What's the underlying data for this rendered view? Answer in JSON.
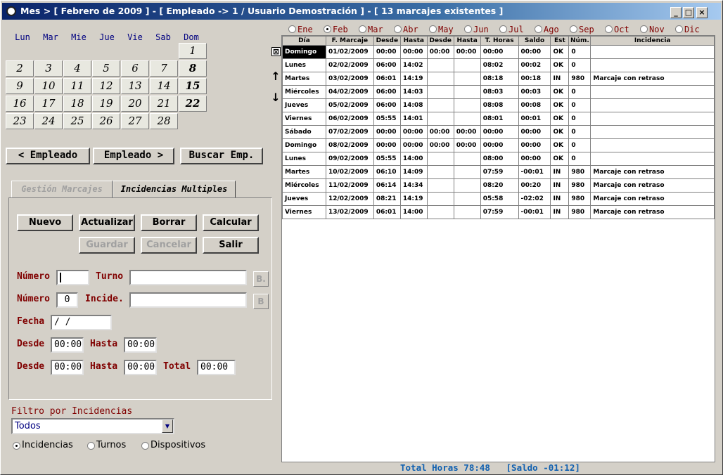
{
  "title": "Mes > [ Febrero de 2009 ] - [ Empleado -> 1 / Usuario Demostración ] - [ 13 marcajes existentes ]",
  "window_buttons": {
    "minimize": "_",
    "maximize": "□",
    "close": "×"
  },
  "calendar": {
    "weekdays": [
      "Lun",
      "Mar",
      "Mie",
      "Jue",
      "Vie",
      "Sab",
      "Dom"
    ],
    "days": [
      "1",
      "2",
      "3",
      "4",
      "5",
      "6",
      "7",
      "8",
      "9",
      "10",
      "11",
      "12",
      "13",
      "14",
      "15",
      "16",
      "17",
      "18",
      "19",
      "20",
      "21",
      "22",
      "23",
      "24",
      "25",
      "26",
      "27",
      "28"
    ]
  },
  "employee_nav": {
    "prev": "< Empleado",
    "next": "Empleado >",
    "search": "Buscar Emp."
  },
  "tabs": {
    "gestion": "Gestión Marcajes",
    "incidencias": "Incidencias Multiples"
  },
  "actions": {
    "nuevo": "Nuevo",
    "actualizar": "Actualizar",
    "borrar": "Borrar",
    "calcular": "Calcular",
    "guardar": "Guardar",
    "cancelar": "Cancelar",
    "salir": "Salir"
  },
  "form": {
    "numero_label": "Número",
    "numero_value": "",
    "turno_label": "Turno",
    "turno_value": "",
    "turno_btn": "B.",
    "numero2_label": "Número",
    "numero2_value": "0",
    "incide_label": "Incide.",
    "incide_value": "",
    "incide_btn": "B",
    "fecha_label": "Fecha",
    "fecha_value": " / /",
    "desde1_label": "Desde",
    "desde1_value": "00:00",
    "hasta1_label": "Hasta",
    "hasta1_value": "00:00",
    "desde2_label": "Desde",
    "desde2_value": "00:00",
    "hasta2_label": "Hasta",
    "hasta2_value": "00:00",
    "total_label": "Total",
    "total_value": "00:00"
  },
  "filter": {
    "label": "Filtro por Incidencias",
    "selected": "Todos",
    "radios": [
      "Incidencias",
      "Turnos",
      "Dispositivos"
    ],
    "radio_selected": 0
  },
  "months": {
    "items": [
      "Ene",
      "Feb",
      "Mar",
      "Abr",
      "May",
      "Jun",
      "Jul",
      "Ago",
      "Sep",
      "Oct",
      "Nov",
      "Dic"
    ],
    "selected": 1
  },
  "grid": {
    "columns": [
      "Día",
      "F. Marcaje",
      "Desde",
      "Hasta",
      "Desde",
      "Hasta",
      "T. Horas",
      "Saldo",
      "Est",
      "Núm.",
      "Incidencia"
    ],
    "rows": [
      [
        "Domingo",
        "01/02/2009",
        "00:00",
        "00:00",
        "00:00",
        "00:00",
        "00:00",
        "00:00",
        "OK",
        "0",
        ""
      ],
      [
        "Lunes",
        "02/02/2009",
        "06:00",
        "14:02",
        "",
        "",
        "08:02",
        "00:02",
        "OK",
        "0",
        ""
      ],
      [
        "Martes",
        "03/02/2009",
        "06:01",
        "14:19",
        "",
        "",
        "08:18",
        "00:18",
        "IN",
        "980",
        "Marcaje con retraso"
      ],
      [
        "Miércoles",
        "04/02/2009",
        "06:00",
        "14:03",
        "",
        "",
        "08:03",
        "00:03",
        "OK",
        "0",
        ""
      ],
      [
        "Jueves",
        "05/02/2009",
        "06:00",
        "14:08",
        "",
        "",
        "08:08",
        "00:08",
        "OK",
        "0",
        ""
      ],
      [
        "Viernes",
        "06/02/2009",
        "05:55",
        "14:01",
        "",
        "",
        "08:01",
        "00:01",
        "OK",
        "0",
        ""
      ],
      [
        "Sábado",
        "07/02/2009",
        "00:00",
        "00:00",
        "00:00",
        "00:00",
        "00:00",
        "00:00",
        "OK",
        "0",
        ""
      ],
      [
        "Domingo",
        "08/02/2009",
        "00:00",
        "00:00",
        "00:00",
        "00:00",
        "00:00",
        "00:00",
        "OK",
        "0",
        ""
      ],
      [
        "Lunes",
        "09/02/2009",
        "05:55",
        "14:00",
        "",
        "",
        "08:00",
        "00:00",
        "OK",
        "0",
        ""
      ],
      [
        "Martes",
        "10/02/2009",
        "06:10",
        "14:09",
        "",
        "",
        "07:59",
        "-00:01",
        "IN",
        "980",
        "Marcaje con retraso"
      ],
      [
        "Miércoles",
        "11/02/2009",
        "06:14",
        "14:34",
        "",
        "",
        "08:20",
        "00:20",
        "IN",
        "980",
        "Marcaje con retraso"
      ],
      [
        "Jueves",
        "12/02/2009",
        "08:21",
        "14:19",
        "",
        "",
        "05:58",
        "-02:02",
        "IN",
        "980",
        "Marcaje con retraso"
      ],
      [
        "Viernes",
        "13/02/2009",
        "06:01",
        "14:00",
        "",
        "",
        "07:59",
        "-00:01",
        "IN",
        "980",
        "Marcaje con retraso"
      ]
    ]
  },
  "footer": {
    "total": "Total Horas 78:48",
    "saldo": "[Saldo -01:12]"
  }
}
